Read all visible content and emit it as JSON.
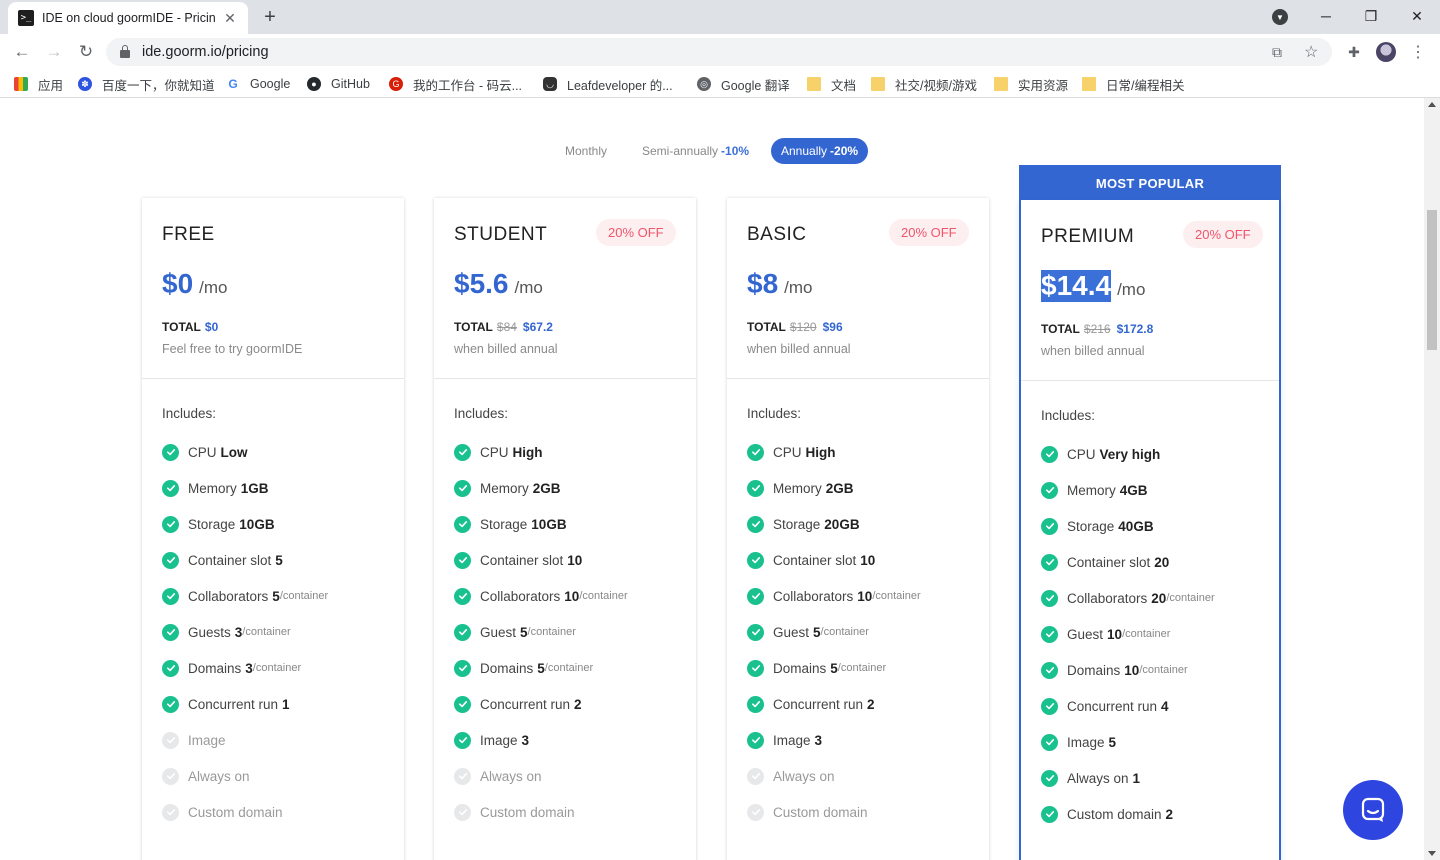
{
  "browser": {
    "tab_title": "IDE on cloud goormIDE - Pricing",
    "tab_close": "✕",
    "new_tab": "+",
    "url": "ide.goorm.io/pricing",
    "bookmarks": [
      "应用",
      "百度一下，你就知道",
      "Google",
      "GitHub",
      "我的工作台 - 码云...",
      "Leafdeveloper 的...",
      "Google 翻译",
      "文档",
      "社交/视频/游戏",
      "实用资源",
      "日常/编程相关"
    ]
  },
  "billing": {
    "options": [
      {
        "label": "Monthly",
        "discount": ""
      },
      {
        "label": "Semi-annually",
        "discount": "-10%"
      },
      {
        "label": "Annually",
        "discount": "-20%"
      }
    ],
    "selected": "Annually"
  },
  "popular_label": "MOST POPULAR",
  "includes_label": "Includes:",
  "per_label": "/mo",
  "total_label": "TOTAL",
  "plans": [
    {
      "name": "FREE",
      "badge": "",
      "price": "$0",
      "total_old": "",
      "total_new": "$0",
      "note": "Feel free to try goormIDE",
      "features": [
        {
          "label": "CPU",
          "value": "Low",
          "unit": "",
          "enabled": true
        },
        {
          "label": "Memory",
          "value": "1GB",
          "unit": "",
          "enabled": true
        },
        {
          "label": "Storage",
          "value": "10GB",
          "unit": "",
          "enabled": true
        },
        {
          "label": "Container slot",
          "value": "5",
          "unit": "",
          "enabled": true
        },
        {
          "label": "Collaborators",
          "value": "5",
          "unit": "/container",
          "enabled": true
        },
        {
          "label": "Guests",
          "value": "3",
          "unit": "/container",
          "enabled": true
        },
        {
          "label": "Domains",
          "value": "3",
          "unit": "/container",
          "enabled": true
        },
        {
          "label": "Concurrent run",
          "value": "1",
          "unit": "",
          "enabled": true
        },
        {
          "label": "Image",
          "value": "",
          "unit": "",
          "enabled": false
        },
        {
          "label": "Always on",
          "value": "",
          "unit": "",
          "enabled": false
        },
        {
          "label": "Custom domain",
          "value": "",
          "unit": "",
          "enabled": false
        }
      ]
    },
    {
      "name": "STUDENT",
      "badge": "20% OFF",
      "price": "$5.6",
      "total_old": "$84",
      "total_new": "$67.2",
      "note": "when billed annual",
      "features": [
        {
          "label": "CPU",
          "value": "High",
          "unit": "",
          "enabled": true
        },
        {
          "label": "Memory",
          "value": "2GB",
          "unit": "",
          "enabled": true
        },
        {
          "label": "Storage",
          "value": "10GB",
          "unit": "",
          "enabled": true
        },
        {
          "label": "Container slot",
          "value": "10",
          "unit": "",
          "enabled": true
        },
        {
          "label": "Collaborators",
          "value": "10",
          "unit": "/container",
          "enabled": true
        },
        {
          "label": "Guest",
          "value": "5",
          "unit": "/container",
          "enabled": true
        },
        {
          "label": "Domains",
          "value": "5",
          "unit": "/container",
          "enabled": true
        },
        {
          "label": "Concurrent run",
          "value": "2",
          "unit": "",
          "enabled": true
        },
        {
          "label": "Image",
          "value": "3",
          "unit": "",
          "enabled": true
        },
        {
          "label": "Always on",
          "value": "",
          "unit": "",
          "enabled": false
        },
        {
          "label": "Custom domain",
          "value": "",
          "unit": "",
          "enabled": false
        }
      ]
    },
    {
      "name": "BASIC",
      "badge": "20% OFF",
      "price": "$8",
      "total_old": "$120",
      "total_new": "$96",
      "note": "when billed annual",
      "features": [
        {
          "label": "CPU",
          "value": "High",
          "unit": "",
          "enabled": true
        },
        {
          "label": "Memory",
          "value": "2GB",
          "unit": "",
          "enabled": true
        },
        {
          "label": "Storage",
          "value": "20GB",
          "unit": "",
          "enabled": true
        },
        {
          "label": "Container slot",
          "value": "10",
          "unit": "",
          "enabled": true
        },
        {
          "label": "Collaborators",
          "value": "10",
          "unit": "/container",
          "enabled": true
        },
        {
          "label": "Guest",
          "value": "5",
          "unit": "/container",
          "enabled": true
        },
        {
          "label": "Domains",
          "value": "5",
          "unit": "/container",
          "enabled": true
        },
        {
          "label": "Concurrent run",
          "value": "2",
          "unit": "",
          "enabled": true
        },
        {
          "label": "Image",
          "value": "3",
          "unit": "",
          "enabled": true
        },
        {
          "label": "Always on",
          "value": "",
          "unit": "",
          "enabled": false
        },
        {
          "label": "Custom domain",
          "value": "",
          "unit": "",
          "enabled": false
        }
      ]
    },
    {
      "name": "PREMIUM",
      "badge": "20% OFF",
      "price": "$14.4",
      "total_old": "$216",
      "total_new": "$172.8",
      "note": "when billed annual",
      "features": [
        {
          "label": "CPU",
          "value": "Very high",
          "unit": "",
          "enabled": true
        },
        {
          "label": "Memory",
          "value": "4GB",
          "unit": "",
          "enabled": true
        },
        {
          "label": "Storage",
          "value": "40GB",
          "unit": "",
          "enabled": true
        },
        {
          "label": "Container slot",
          "value": "20",
          "unit": "",
          "enabled": true
        },
        {
          "label": "Collaborators",
          "value": "20",
          "unit": "/container",
          "enabled": true
        },
        {
          "label": "Guest",
          "value": "10",
          "unit": "/container",
          "enabled": true
        },
        {
          "label": "Domains",
          "value": "10",
          "unit": "/container",
          "enabled": true
        },
        {
          "label": "Concurrent run",
          "value": "4",
          "unit": "",
          "enabled": true
        },
        {
          "label": "Image",
          "value": "5",
          "unit": "",
          "enabled": true
        },
        {
          "label": "Always on",
          "value": "1",
          "unit": "",
          "enabled": true
        },
        {
          "label": "Custom domain",
          "value": "2",
          "unit": "",
          "enabled": true
        }
      ]
    }
  ],
  "colors": {
    "accent": "#3466d1",
    "check": "#19c18f",
    "badge_text": "#f0566b",
    "chat": "#2f45e0"
  }
}
